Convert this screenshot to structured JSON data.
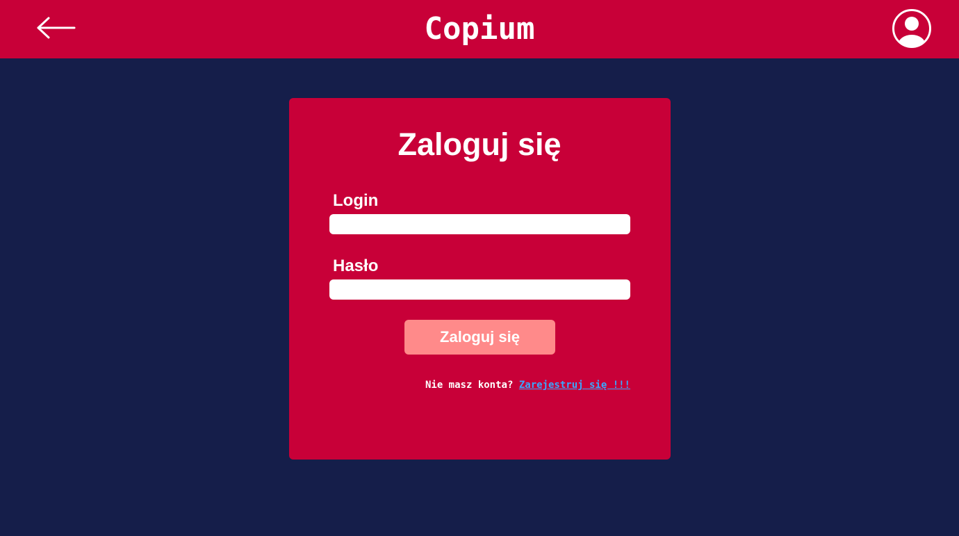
{
  "header": {
    "title": "Copium",
    "back_icon": "arrow-left-icon",
    "profile_icon": "user-circle-icon"
  },
  "login_form": {
    "title": "Zaloguj się",
    "login_label": "Login",
    "login_value": "",
    "password_label": "Hasło",
    "password_value": "",
    "submit_label": "Zaloguj się",
    "no_account_text": "Nie masz konta?",
    "register_link": "Zarejestruj się !!!"
  },
  "colors": {
    "background": "#151e4a",
    "primary": "#c80038",
    "button": "#ff8a8a",
    "link": "#3aa8ff"
  }
}
